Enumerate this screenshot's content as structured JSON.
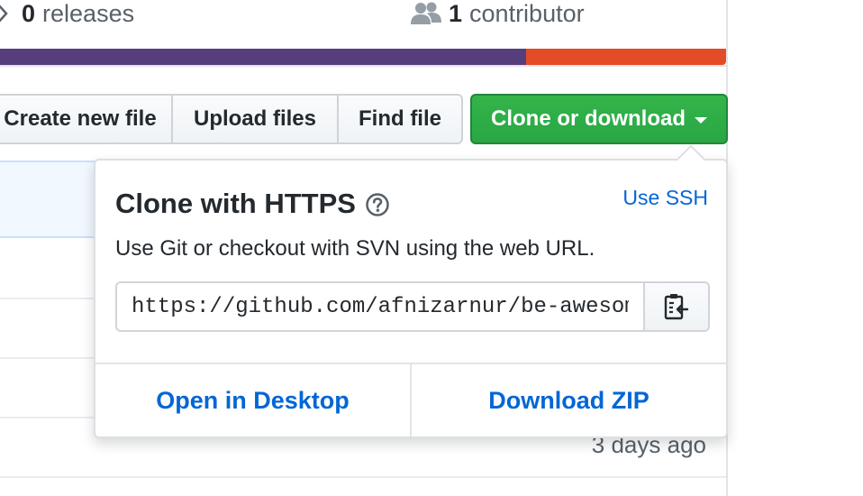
{
  "stats": {
    "releases_count": "0",
    "releases_label": "releases",
    "contributors_count": "1",
    "contributors_label": "contributor"
  },
  "languages_bar": {
    "segments": [
      {
        "color": "#563d7c",
        "share": 0.725
      },
      {
        "color": "#e34c26",
        "share": 0.275
      }
    ]
  },
  "toolbar": {
    "create_label": "Create new file",
    "upload_label": "Upload files",
    "find_label": "Find file",
    "clone_label": "Clone or download"
  },
  "clone_dropdown": {
    "title": "Clone with HTTPS",
    "use_ssh_label": "Use SSH",
    "description": "Use Git or checkout with SVN using the web URL.",
    "url_value": "https://github.com/afnizarnur/be-awesome",
    "open_desktop_label": "Open in Desktop",
    "download_zip_label": "Download ZIP"
  },
  "file_list": {
    "visible_age": "3 days ago"
  },
  "colors": {
    "link": "#0366d6",
    "clone_button": "#28a745"
  }
}
